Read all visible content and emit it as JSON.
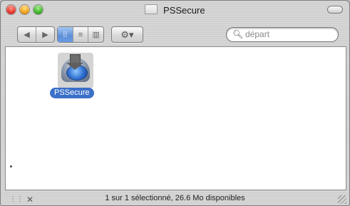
{
  "window": {
    "title": "PSSecure"
  },
  "toolbar": {
    "back_icon": "back-icon",
    "forward_icon": "forward-icon",
    "view_icons": [
      "icon-view-icon",
      "list-view-icon",
      "column-view-icon"
    ],
    "action_icon": "gear-icon",
    "search_placeholder": "départ"
  },
  "content": {
    "selected_item": {
      "label": "PSSecure",
      "icon": "disk-image-icon"
    }
  },
  "status": {
    "text": "1 sur 1 sélectionné, 26.6 Mo disponibles"
  }
}
